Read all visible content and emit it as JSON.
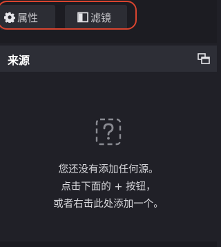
{
  "tabs": {
    "properties_label": "属性",
    "filters_label": "滤镜"
  },
  "sources_dock": {
    "title": "来源",
    "empty_lines": [
      "您还没有添加任何源。",
      "点击下面的 + 按钮，",
      "或者右击此处添加一个。"
    ]
  },
  "icons": {
    "properties": "gear-icon",
    "filters": "filter-icon",
    "undock": "undock-icon",
    "empty": "question-icon"
  },
  "colors": {
    "highlight": "#d9442f",
    "panel_bg": "#202027",
    "header_bg": "#2d2e36",
    "tab_bg": "#2c2d34"
  }
}
